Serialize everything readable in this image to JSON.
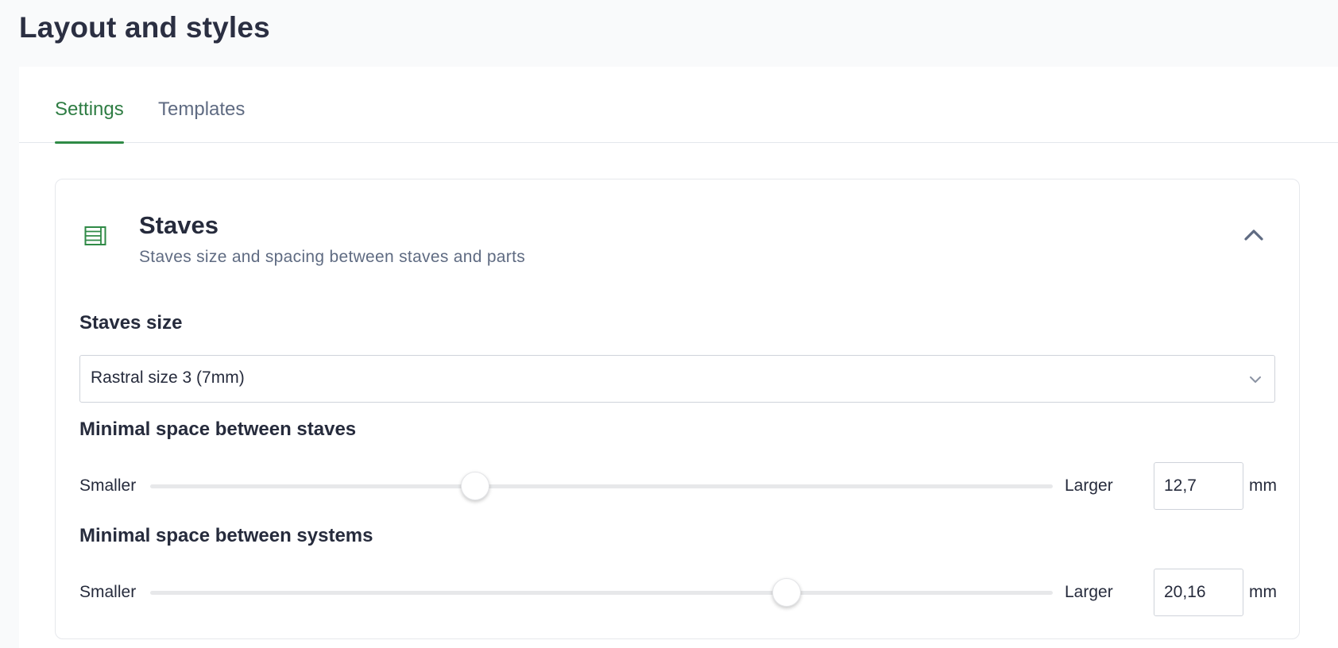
{
  "page": {
    "title": "Layout and styles"
  },
  "tabs": [
    {
      "label": "Settings",
      "active": true
    },
    {
      "label": "Templates",
      "active": false
    }
  ],
  "colors": {
    "accent": "#2f8a46",
    "title_text": "#262b3c",
    "muted_text": "#5f6b82"
  },
  "card": {
    "icon": "staves-icon",
    "title": "Staves",
    "subtitle": "Staves size and spacing between staves and parts",
    "expanded": true,
    "collapse_icon": "chevron-up-icon"
  },
  "staves_size": {
    "label": "Staves size",
    "selected": "Rastral size 3 (7mm)"
  },
  "staves_spacing": {
    "label": "Minimal space between staves",
    "min_label": "Smaller",
    "max_label": "Larger",
    "value": "12,7",
    "unit": "mm",
    "level": 0.36
  },
  "systems_spacing": {
    "label": "Minimal space between systems",
    "min_label": "Smaller",
    "max_label": "Larger",
    "value": "20,16",
    "unit": "mm",
    "level": 0.705
  }
}
